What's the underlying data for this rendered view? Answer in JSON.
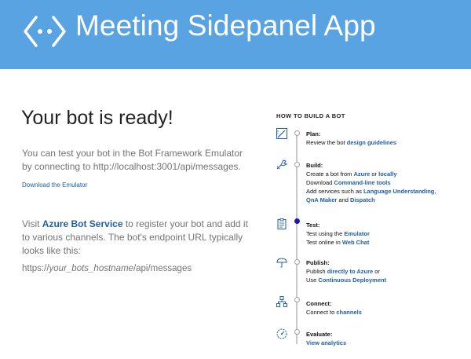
{
  "header": {
    "title": "Meeting Sidepanel App"
  },
  "main": {
    "heading": "Your bot is ready!",
    "intro_line1": "You can test your bot in the Bot Framework Emulator",
    "intro_line2": "by connecting to http://localhost:3001/api/messages.",
    "download_link": "Download the Emulator",
    "visit_prefix": "Visit ",
    "visit_link": "Azure Bot Service",
    "visit_suffix": " to register your bot and add it to various channels. The bot's endpoint URL typically looks like this:",
    "endpoint_prefix": "https://",
    "endpoint_italic": "your_bots_hostname",
    "endpoint_suffix": "/api/messages"
  },
  "howto": {
    "title": "HOW TO BUILD A BOT",
    "plan": {
      "head": "Plan:",
      "line1_text": "Review the bot ",
      "line1_link": "design guidelines"
    },
    "build": {
      "head": "Build:",
      "l1_text": "Create a bot from ",
      "l1_link1": "Azure",
      "l1_mid": " or ",
      "l1_link2": "locally",
      "l2_text": "Download ",
      "l2_link": "Command-line tools",
      "l3_text": "Add services such as ",
      "l3_link": "Language Understanding",
      "l3_end": ",",
      "l4_link1": "QnA Maker",
      "l4_mid": " and ",
      "l4_link2": "Dispatch"
    },
    "test": {
      "head": "Test:",
      "l1_text": "Test using the ",
      "l1_link": "Emulator",
      "l2_text": "Test online in ",
      "l2_link": "Web Chat"
    },
    "publish": {
      "head": "Publish:",
      "l1_text": "Publish ",
      "l1_link": "directly to Azure",
      "l1_end": " or",
      "l2_text": "Use ",
      "l2_link": "Continuous Deployment"
    },
    "connect": {
      "head": "Connect:",
      "l1_text": "Connect to ",
      "l1_link": "channels"
    },
    "evaluate": {
      "head": "Evaluate:",
      "l1_link": "View analytics"
    }
  },
  "colors": {
    "header_bg": "#59a3e3",
    "link": "#1f5ea8",
    "active_dot": "#1a1aa6"
  },
  "icons": [
    "bot-framework-logo-icon",
    "pencil-ruler-icon",
    "wrench-hand-icon",
    "clipboard-icon",
    "cloud-umbrella-icon",
    "network-icon",
    "gauge-icon"
  ]
}
